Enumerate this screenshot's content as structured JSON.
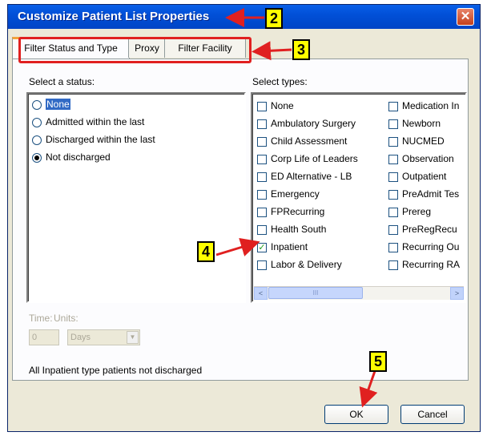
{
  "dialog": {
    "title": "Customize Patient List Properties",
    "close_glyph": "✕"
  },
  "tabs": [
    {
      "label": "Filter Status and Type",
      "active": true
    },
    {
      "label": "Proxy",
      "active": false
    },
    {
      "label": "Filter Facility",
      "active": false
    }
  ],
  "status": {
    "heading": "Select a status:",
    "options": [
      {
        "label": "None",
        "checked": false,
        "selected": true
      },
      {
        "label": "Admitted within the last",
        "checked": false
      },
      {
        "label": "Discharged within the last",
        "checked": false
      },
      {
        "label": "Not discharged",
        "checked": true
      }
    ]
  },
  "types": {
    "heading": "Select types:",
    "col1": [
      {
        "label": "None",
        "checked": false
      },
      {
        "label": "Ambulatory Surgery",
        "checked": false
      },
      {
        "label": "Child Assessment",
        "checked": false
      },
      {
        "label": "Corp Life of Leaders",
        "checked": false
      },
      {
        "label": "ED Alternative - LB",
        "checked": false
      },
      {
        "label": "Emergency",
        "checked": false
      },
      {
        "label": "FPRecurring",
        "checked": false
      },
      {
        "label": "Health South",
        "checked": false
      },
      {
        "label": "Inpatient",
        "checked": true
      },
      {
        "label": "Labor & Delivery",
        "checked": false
      }
    ],
    "col2": [
      {
        "label": "Medication In",
        "checked": false
      },
      {
        "label": "Newborn",
        "checked": false
      },
      {
        "label": "NUCMED",
        "checked": false
      },
      {
        "label": "Observation",
        "checked": false
      },
      {
        "label": "Outpatient",
        "checked": false
      },
      {
        "label": "PreAdmit Tes",
        "checked": false
      },
      {
        "label": "Prereg",
        "checked": false
      },
      {
        "label": "PreRegRecu",
        "checked": false
      },
      {
        "label": "Recurring Ou",
        "checked": false
      },
      {
        "label": "Recurring RA",
        "checked": false
      }
    ],
    "scroll_left": "<",
    "scroll_right": ">",
    "thumb_grip": "III"
  },
  "time": {
    "time_label": "Time:",
    "units_label": "Units:",
    "value": "0",
    "units_value": "Days",
    "dropdown_arrow": "▼"
  },
  "summary": "All Inpatient type patients not discharged",
  "buttons": {
    "ok": "OK",
    "cancel": "Cancel"
  },
  "annotations": [
    "2",
    "3",
    "4",
    "5"
  ],
  "colors": {
    "title_bar": "#0150d8",
    "callout_fill": "#ffff00",
    "annotation_red": "#e02020",
    "selection": "#316ac5"
  }
}
